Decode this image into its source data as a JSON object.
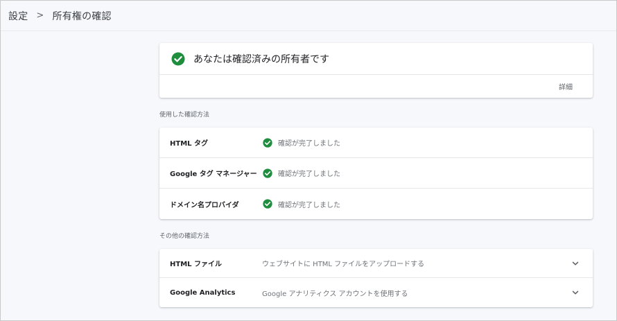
{
  "breadcrumb": {
    "parent": "設定",
    "separator": ">",
    "current": "所有権の確認"
  },
  "owner_card": {
    "title": "あなたは確認済みの所有者です",
    "details_link": "詳細",
    "check_color": "#1e8e3e"
  },
  "used_methods": {
    "label": "使用した確認方法",
    "items": [
      {
        "name": "HTML タグ",
        "status": "確認が完了しました"
      },
      {
        "name": "Google タグ マネージャー",
        "status": "確認が完了しました"
      },
      {
        "name": "ドメイン名プロバイダ",
        "status": "確認が完了しました"
      }
    ]
  },
  "other_methods": {
    "label": "その他の確認方法",
    "items": [
      {
        "name": "HTML ファイル",
        "description": "ウェブサイトに HTML ファイルをアップロードする"
      },
      {
        "name": "Google Analytics",
        "description": "Google アナリティクス アカウントを使用する"
      }
    ]
  }
}
